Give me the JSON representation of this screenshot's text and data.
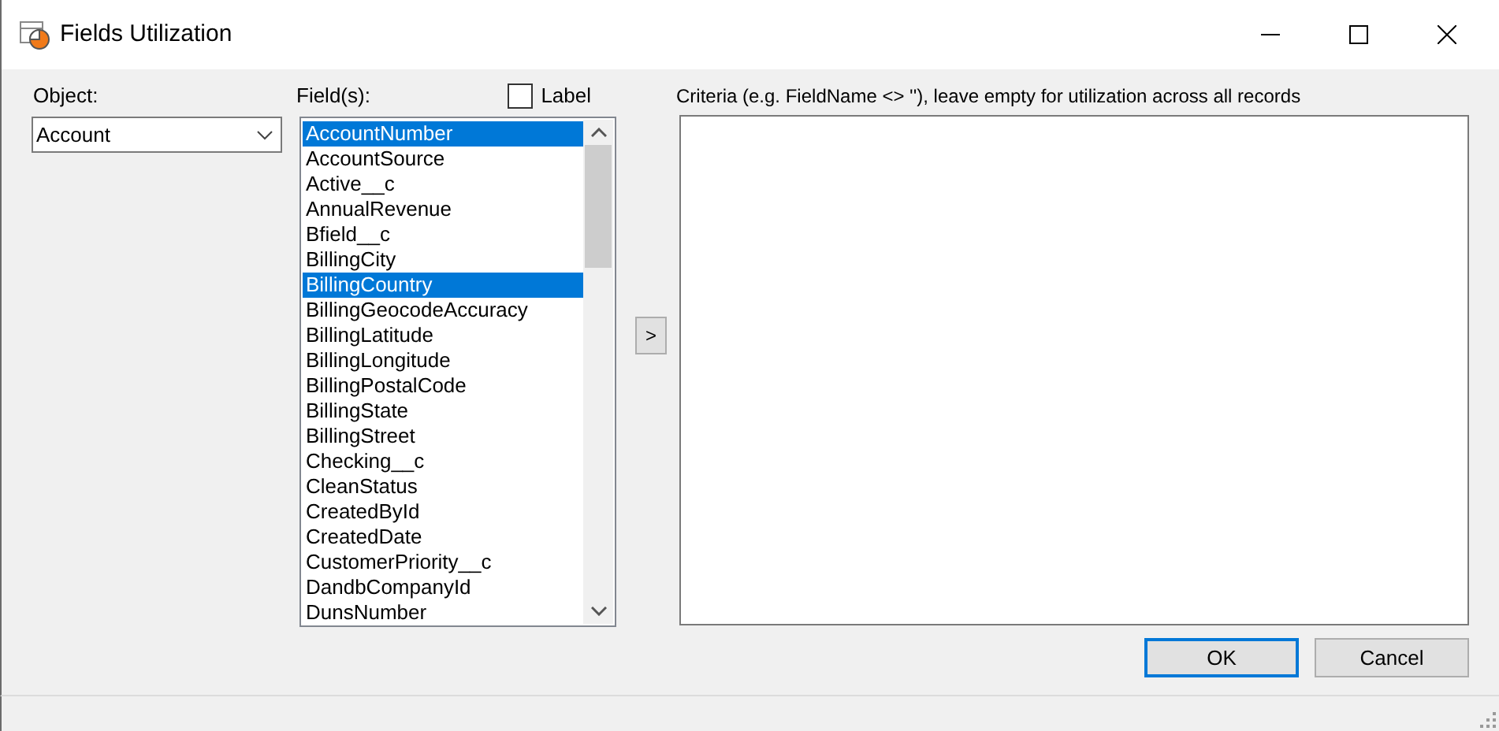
{
  "window": {
    "title": "Fields Utilization"
  },
  "object": {
    "label": "Object:",
    "value": "Account"
  },
  "fields": {
    "label": "Field(s):",
    "label_option": {
      "text": "Label",
      "checked": false
    },
    "items": [
      {
        "text": "AccountNumber",
        "selected": true
      },
      {
        "text": "AccountSource",
        "selected": false
      },
      {
        "text": "Active__c",
        "selected": false
      },
      {
        "text": "AnnualRevenue",
        "selected": false
      },
      {
        "text": "Bfield__c",
        "selected": false
      },
      {
        "text": "BillingCity",
        "selected": false
      },
      {
        "text": "BillingCountry",
        "selected": true
      },
      {
        "text": "BillingGeocodeAccuracy",
        "selected": false
      },
      {
        "text": "BillingLatitude",
        "selected": false
      },
      {
        "text": "BillingLongitude",
        "selected": false
      },
      {
        "text": "BillingPostalCode",
        "selected": false
      },
      {
        "text": "BillingState",
        "selected": false
      },
      {
        "text": "BillingStreet",
        "selected": false
      },
      {
        "text": "Checking__c",
        "selected": false
      },
      {
        "text": "CleanStatus",
        "selected": false
      },
      {
        "text": "CreatedById",
        "selected": false
      },
      {
        "text": "CreatedDate",
        "selected": false
      },
      {
        "text": "CustomerPriority__c",
        "selected": false
      },
      {
        "text": "DandbCompanyId",
        "selected": false
      },
      {
        "text": "DunsNumber",
        "selected": false
      }
    ]
  },
  "move_button": ">",
  "criteria": {
    "label": "Criteria (e.g. FieldName <> ''), leave empty for  utilization across all records"
  },
  "buttons": [
    {
      "label": "OK",
      "default": true
    },
    {
      "label": "Cancel",
      "default": false
    }
  ]
}
